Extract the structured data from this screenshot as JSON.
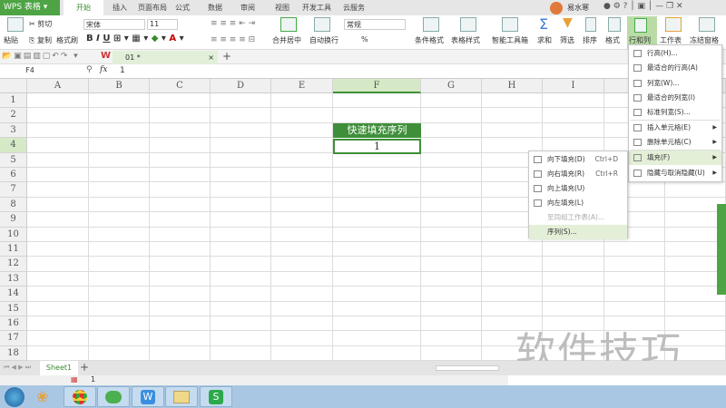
{
  "app": {
    "title": "WPS 表格",
    "user": "易水寒"
  },
  "tabs": [
    "开始",
    "插入",
    "页面布局",
    "公式",
    "数据",
    "审阅",
    "视图",
    "开发工具",
    "云服务"
  ],
  "ribbon": {
    "paste": "粘贴",
    "cut": "剪切",
    "copy": "复制",
    "format_painter": "格式刷",
    "font": "宋体",
    "size": "11",
    "merge": "合并居中",
    "wrap": "自动换行",
    "number_format": "常规",
    "percent": "%",
    "cond_format": "条件格式",
    "table_style": "表格样式",
    "smart_toolbox": "智能工具箱",
    "sum": "求和",
    "filter": "筛选",
    "sort": "排序",
    "format": "格式",
    "rows_cols": "行和列",
    "worksheet": "工作表",
    "freeze": "冻结窗格"
  },
  "document_tab": "01 *",
  "formula_bar": {
    "cell_ref": "F4",
    "fx": "fx",
    "value": "1"
  },
  "columns": [
    "A",
    "B",
    "C",
    "D",
    "E",
    "F",
    "G",
    "H",
    "I"
  ],
  "rows": [
    "1",
    "2",
    "3",
    "4",
    "5",
    "6",
    "7",
    "8",
    "9",
    "10",
    "11",
    "12",
    "13",
    "14",
    "15",
    "16",
    "17",
    "18"
  ],
  "cells": {
    "F3": "快速填充序列",
    "F4": "1"
  },
  "menu": [
    {
      "label": "行高(H)..."
    },
    {
      "label": "最适合的行高(A)"
    },
    {
      "label": "列宽(W)..."
    },
    {
      "label": "最适合的列宽(I)"
    },
    {
      "label": "标准列宽(S)..."
    },
    {
      "label": "插入单元格(E)"
    },
    {
      "label": "删除单元格(C)"
    },
    {
      "label": "填充(F)"
    },
    {
      "label": "隐藏与取消隐藏(U)"
    }
  ],
  "submenu": [
    {
      "label": "向下填充(D)",
      "shortcut": "Ctrl+D"
    },
    {
      "label": "向右填充(R)",
      "shortcut": "Ctrl+R"
    },
    {
      "label": "向上填充(U)"
    },
    {
      "label": "向左填充(L)"
    },
    {
      "label": "至同组工作表(A)..."
    },
    {
      "label": "序列(S)..."
    }
  ],
  "sheet_tabs": [
    "Sheet1"
  ],
  "status": {
    "page": "1"
  },
  "watermark": "软件技巧",
  "colors": {
    "accent": "#4ea444",
    "highlight": "#e3efd7",
    "header_selected": "#d6e9c6"
  }
}
